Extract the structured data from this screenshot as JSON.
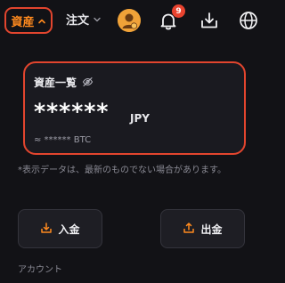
{
  "header": {
    "assets_label": "資産",
    "orders_label": "注文",
    "notification_count": "9"
  },
  "asset_card": {
    "title": "資産一覧",
    "amount_masked": "******",
    "currency": "JPY",
    "btc_equivalent": "≈ ****** BTC"
  },
  "notice": "*表示データは、最新のものでない場合があります。",
  "actions": {
    "deposit_label": "入金",
    "withdraw_label": "出金"
  },
  "section": {
    "account_label": "アカウント"
  },
  "colors": {
    "accent": "#ff8a1e",
    "highlight_border": "#e2452e",
    "badge": "#e8432f",
    "background": "#121216"
  },
  "icons": [
    "chevron-up-icon",
    "chevron-down-icon",
    "avatar-icon",
    "bell-icon",
    "download-icon",
    "globe-icon",
    "eye-off-icon",
    "deposit-icon",
    "withdraw-icon"
  ]
}
